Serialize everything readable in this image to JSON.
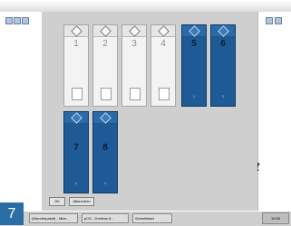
{
  "background": {
    "colors": {
      "dialog": "#cfcfcf",
      "slot_off": "#f3f3f3",
      "slot_on": "#1e5a96",
      "badge": "#2b6ea6"
    },
    "right_fragment_text": "rt"
  },
  "dialog": {
    "slots": [
      {
        "label": "1",
        "state": "inactive"
      },
      {
        "label": "2",
        "state": "inactive"
      },
      {
        "label": "3",
        "state": "inactive"
      },
      {
        "label": "4",
        "state": "inactive"
      },
      {
        "label": "5",
        "state": "active",
        "sub": "1"
      },
      {
        "label": "6",
        "state": "active",
        "sub": "2"
      },
      {
        "label": "7",
        "state": "active",
        "sub": "3"
      },
      {
        "label": "8",
        "state": "active",
        "sub": "4"
      }
    ],
    "buttons": {
      "ok": "OK",
      "cancel": "Abbrechen"
    }
  },
  "taskbar": {
    "items": [
      "(Wunderpaket) - Mics...",
      "pCD - Drehbar 8...",
      "Schnellstart"
    ],
    "clock": "10:55"
  },
  "figure_number": "7"
}
